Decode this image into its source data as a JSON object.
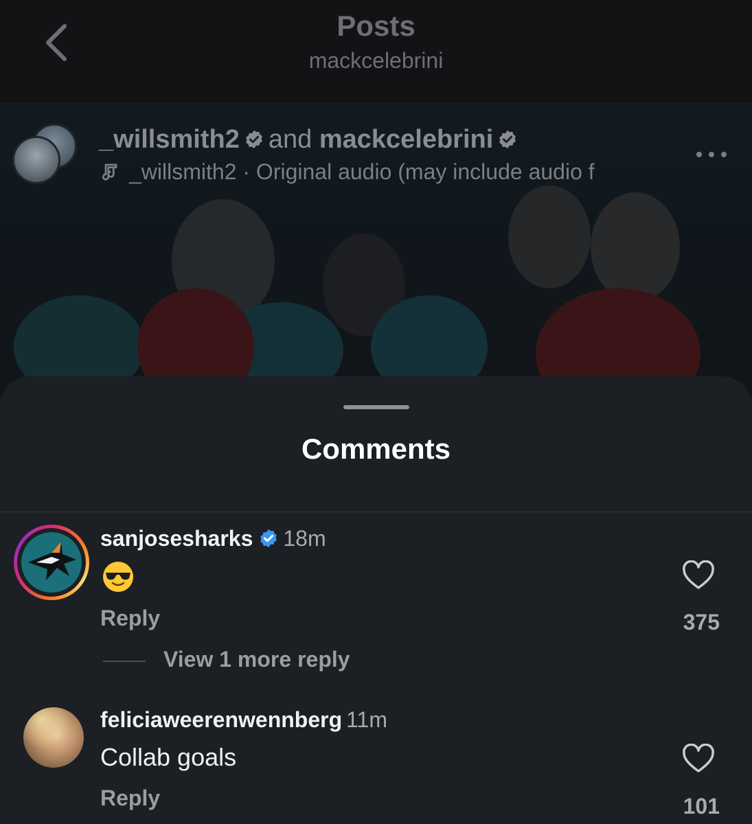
{
  "header": {
    "title": "Posts",
    "subtitle": "mackcelebrini"
  },
  "post": {
    "collab_user_1": "_willsmith2",
    "collab_joiner": "and",
    "collab_user_2": "mackcelebrini",
    "audio_text": "_willsmith2 · Original audio  (may include audio f"
  },
  "sheet": {
    "title": "Comments"
  },
  "comments": [
    {
      "username": "sanjosesharks",
      "time": "18m",
      "text": "😎",
      "reply_label": "Reply",
      "likes": "375",
      "view_more": "View 1 more reply"
    },
    {
      "username": "feliciaweerenwennberg",
      "time": "11m",
      "text": "Collab goals",
      "reply_label": "Reply",
      "likes": "101"
    }
  ],
  "colors": {
    "background": "#0f1113",
    "sheet": "#1c1f23",
    "verified_blue": "#3897f0",
    "shark_teal": "#1a6f78"
  },
  "icons": [
    "back-chevron-icon",
    "verified-icon",
    "music-note-icon",
    "more-dots-icon",
    "heart-icon",
    "sunglasses-emoji"
  ]
}
